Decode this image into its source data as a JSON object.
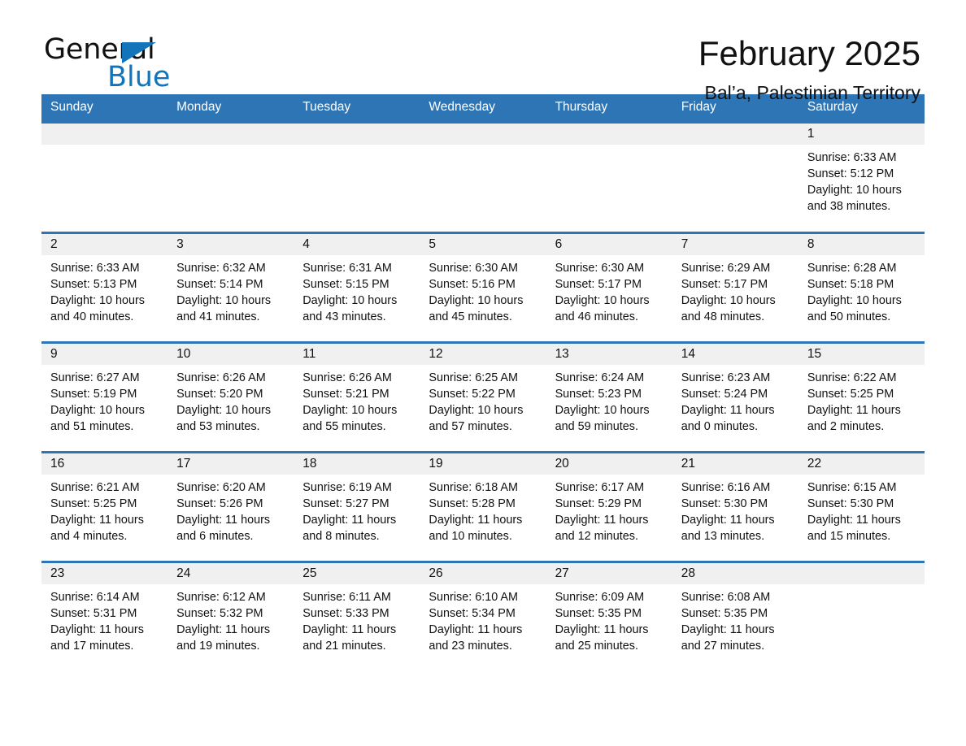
{
  "brand": {
    "name_part1": "General",
    "name_part2": "Blue",
    "triangle_color": "#1275bc"
  },
  "header": {
    "title": "February 2025",
    "subtitle": "Bal’a, Palestinian Territory"
  },
  "theme": {
    "header_blue": "#2e75b6",
    "daynum_gray": "#f0f0f0",
    "text": "#111111"
  },
  "weekday_headers": [
    "Sunday",
    "Monday",
    "Tuesday",
    "Wednesday",
    "Thursday",
    "Friday",
    "Saturday"
  ],
  "weeks": [
    [
      {
        "day": "",
        "empty": true
      },
      {
        "day": "",
        "empty": true
      },
      {
        "day": "",
        "empty": true
      },
      {
        "day": "",
        "empty": true
      },
      {
        "day": "",
        "empty": true
      },
      {
        "day": "",
        "empty": true
      },
      {
        "day": "1",
        "sunrise": "Sunrise: 6:33 AM",
        "sunset": "Sunset: 5:12 PM",
        "daylight_line1": "Daylight: 10 hours",
        "daylight_line2": "and 38 minutes."
      }
    ],
    [
      {
        "day": "2",
        "sunrise": "Sunrise: 6:33 AM",
        "sunset": "Sunset: 5:13 PM",
        "daylight_line1": "Daylight: 10 hours",
        "daylight_line2": "and 40 minutes."
      },
      {
        "day": "3",
        "sunrise": "Sunrise: 6:32 AM",
        "sunset": "Sunset: 5:14 PM",
        "daylight_line1": "Daylight: 10 hours",
        "daylight_line2": "and 41 minutes."
      },
      {
        "day": "4",
        "sunrise": "Sunrise: 6:31 AM",
        "sunset": "Sunset: 5:15 PM",
        "daylight_line1": "Daylight: 10 hours",
        "daylight_line2": "and 43 minutes."
      },
      {
        "day": "5",
        "sunrise": "Sunrise: 6:30 AM",
        "sunset": "Sunset: 5:16 PM",
        "daylight_line1": "Daylight: 10 hours",
        "daylight_line2": "and 45 minutes."
      },
      {
        "day": "6",
        "sunrise": "Sunrise: 6:30 AM",
        "sunset": "Sunset: 5:17 PM",
        "daylight_line1": "Daylight: 10 hours",
        "daylight_line2": "and 46 minutes."
      },
      {
        "day": "7",
        "sunrise": "Sunrise: 6:29 AM",
        "sunset": "Sunset: 5:17 PM",
        "daylight_line1": "Daylight: 10 hours",
        "daylight_line2": "and 48 minutes."
      },
      {
        "day": "8",
        "sunrise": "Sunrise: 6:28 AM",
        "sunset": "Sunset: 5:18 PM",
        "daylight_line1": "Daylight: 10 hours",
        "daylight_line2": "and 50 minutes."
      }
    ],
    [
      {
        "day": "9",
        "sunrise": "Sunrise: 6:27 AM",
        "sunset": "Sunset: 5:19 PM",
        "daylight_line1": "Daylight: 10 hours",
        "daylight_line2": "and 51 minutes."
      },
      {
        "day": "10",
        "sunrise": "Sunrise: 6:26 AM",
        "sunset": "Sunset: 5:20 PM",
        "daylight_line1": "Daylight: 10 hours",
        "daylight_line2": "and 53 minutes."
      },
      {
        "day": "11",
        "sunrise": "Sunrise: 6:26 AM",
        "sunset": "Sunset: 5:21 PM",
        "daylight_line1": "Daylight: 10 hours",
        "daylight_line2": "and 55 minutes."
      },
      {
        "day": "12",
        "sunrise": "Sunrise: 6:25 AM",
        "sunset": "Sunset: 5:22 PM",
        "daylight_line1": "Daylight: 10 hours",
        "daylight_line2": "and 57 minutes."
      },
      {
        "day": "13",
        "sunrise": "Sunrise: 6:24 AM",
        "sunset": "Sunset: 5:23 PM",
        "daylight_line1": "Daylight: 10 hours",
        "daylight_line2": "and 59 minutes."
      },
      {
        "day": "14",
        "sunrise": "Sunrise: 6:23 AM",
        "sunset": "Sunset: 5:24 PM",
        "daylight_line1": "Daylight: 11 hours",
        "daylight_line2": "and 0 minutes."
      },
      {
        "day": "15",
        "sunrise": "Sunrise: 6:22 AM",
        "sunset": "Sunset: 5:25 PM",
        "daylight_line1": "Daylight: 11 hours",
        "daylight_line2": "and 2 minutes."
      }
    ],
    [
      {
        "day": "16",
        "sunrise": "Sunrise: 6:21 AM",
        "sunset": "Sunset: 5:25 PM",
        "daylight_line1": "Daylight: 11 hours",
        "daylight_line2": "and 4 minutes."
      },
      {
        "day": "17",
        "sunrise": "Sunrise: 6:20 AM",
        "sunset": "Sunset: 5:26 PM",
        "daylight_line1": "Daylight: 11 hours",
        "daylight_line2": "and 6 minutes."
      },
      {
        "day": "18",
        "sunrise": "Sunrise: 6:19 AM",
        "sunset": "Sunset: 5:27 PM",
        "daylight_line1": "Daylight: 11 hours",
        "daylight_line2": "and 8 minutes."
      },
      {
        "day": "19",
        "sunrise": "Sunrise: 6:18 AM",
        "sunset": "Sunset: 5:28 PM",
        "daylight_line1": "Daylight: 11 hours",
        "daylight_line2": "and 10 minutes."
      },
      {
        "day": "20",
        "sunrise": "Sunrise: 6:17 AM",
        "sunset": "Sunset: 5:29 PM",
        "daylight_line1": "Daylight: 11 hours",
        "daylight_line2": "and 12 minutes."
      },
      {
        "day": "21",
        "sunrise": "Sunrise: 6:16 AM",
        "sunset": "Sunset: 5:30 PM",
        "daylight_line1": "Daylight: 11 hours",
        "daylight_line2": "and 13 minutes."
      },
      {
        "day": "22",
        "sunrise": "Sunrise: 6:15 AM",
        "sunset": "Sunset: 5:30 PM",
        "daylight_line1": "Daylight: 11 hours",
        "daylight_line2": "and 15 minutes."
      }
    ],
    [
      {
        "day": "23",
        "sunrise": "Sunrise: 6:14 AM",
        "sunset": "Sunset: 5:31 PM",
        "daylight_line1": "Daylight: 11 hours",
        "daylight_line2": "and 17 minutes."
      },
      {
        "day": "24",
        "sunrise": "Sunrise: 6:12 AM",
        "sunset": "Sunset: 5:32 PM",
        "daylight_line1": "Daylight: 11 hours",
        "daylight_line2": "and 19 minutes."
      },
      {
        "day": "25",
        "sunrise": "Sunrise: 6:11 AM",
        "sunset": "Sunset: 5:33 PM",
        "daylight_line1": "Daylight: 11 hours",
        "daylight_line2": "and 21 minutes."
      },
      {
        "day": "26",
        "sunrise": "Sunrise: 6:10 AM",
        "sunset": "Sunset: 5:34 PM",
        "daylight_line1": "Daylight: 11 hours",
        "daylight_line2": "and 23 minutes."
      },
      {
        "day": "27",
        "sunrise": "Sunrise: 6:09 AM",
        "sunset": "Sunset: 5:35 PM",
        "daylight_line1": "Daylight: 11 hours",
        "daylight_line2": "and 25 minutes."
      },
      {
        "day": "28",
        "sunrise": "Sunrise: 6:08 AM",
        "sunset": "Sunset: 5:35 PM",
        "daylight_line1": "Daylight: 11 hours",
        "daylight_line2": "and 27 minutes."
      },
      {
        "day": "",
        "empty": true
      }
    ]
  ]
}
